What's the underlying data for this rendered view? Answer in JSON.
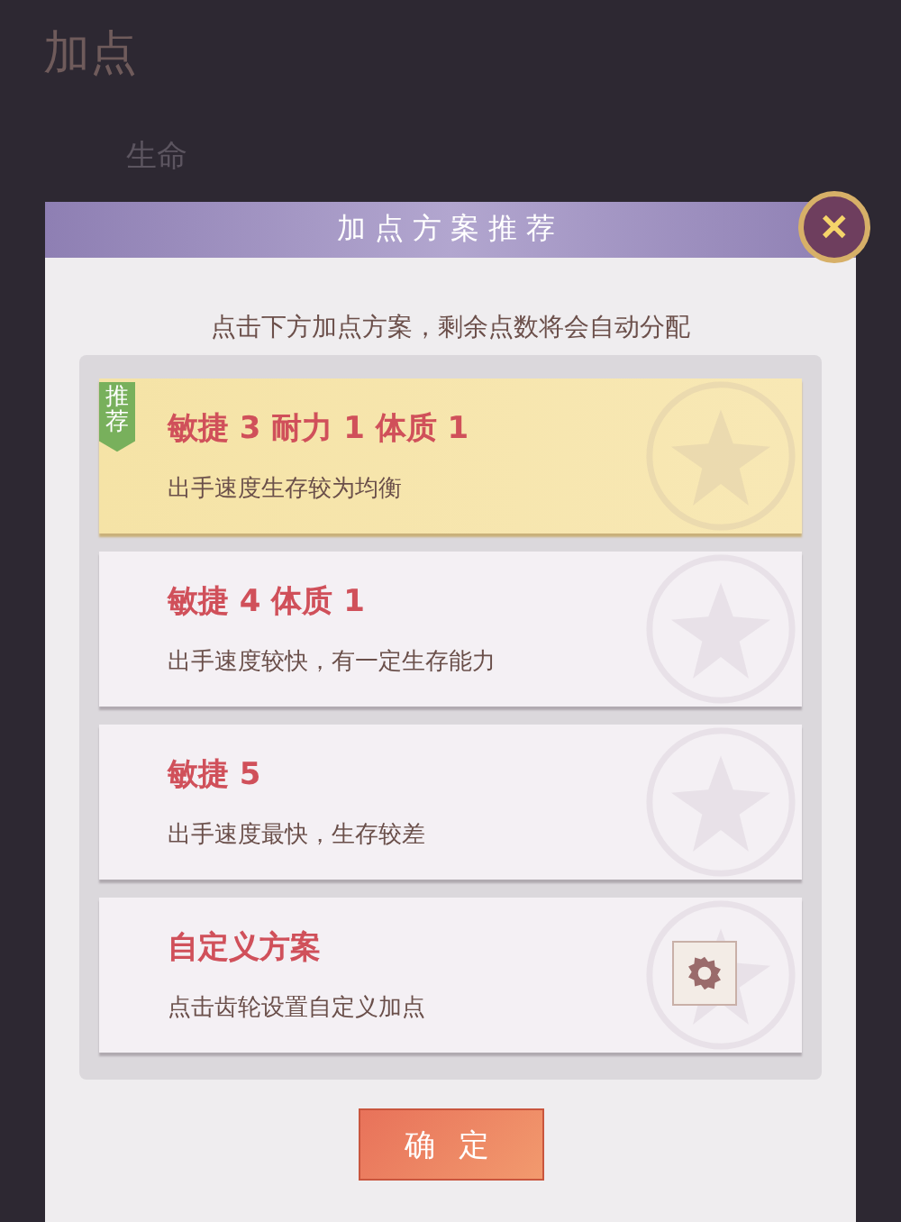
{
  "background": {
    "title": "加点",
    "stat_label": "生命"
  },
  "dialog": {
    "title": "加点方案推荐",
    "close": "✕",
    "hint": "点击下方加点方案，剩余点数将会自动分配",
    "plans": [
      {
        "kind": "plan",
        "name": "敏捷 3 耐力 1 体质 1",
        "desc": "出手速度生存较为均衡",
        "selected": true,
        "badge": "推荐"
      },
      {
        "kind": "plan",
        "name": "敏捷 4 体质 1",
        "desc": "出手速度较快，有一定生存能力",
        "selected": false
      },
      {
        "kind": "plan",
        "name": "敏捷 5",
        "desc": "出手速度最快，生存较差",
        "selected": false
      },
      {
        "kind": "custom",
        "name": "自定义方案",
        "desc": "点击齿轮设置自定义加点",
        "selected": false
      }
    ],
    "confirm": "确 定"
  }
}
